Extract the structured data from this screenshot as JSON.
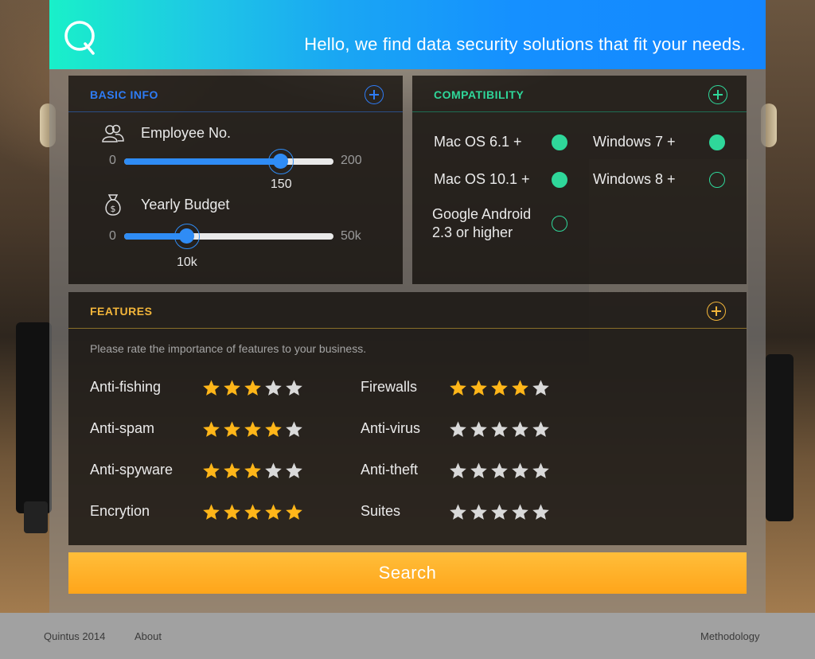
{
  "header": {
    "tagline": "Hello, we find data security solutions that fit your needs."
  },
  "basic_info": {
    "title": "BASIC INFO",
    "employees": {
      "label": "Employee No.",
      "min": "0",
      "max": "200",
      "value": "150",
      "fraction": 0.75
    },
    "budget": {
      "label": "Yearly Budget",
      "min": "0",
      "max": "50k",
      "value": "10k",
      "fraction": 0.3
    }
  },
  "compatibility": {
    "title": "COMPATIBILITY",
    "options": [
      {
        "label": "Mac OS 6.1 +",
        "checked": true
      },
      {
        "label": "Windows 7 +",
        "checked": true
      },
      {
        "label": "Mac OS 10.1 +",
        "checked": true
      },
      {
        "label": "Windows 8 +",
        "checked": false
      },
      {
        "label": "Google Android\n2.3 or higher",
        "checked": false
      }
    ]
  },
  "features": {
    "title": "FEATURES",
    "hint": "Please rate the importance of features to your business.",
    "items": [
      {
        "label": "Anti-fishing",
        "rating": 3
      },
      {
        "label": "Firewalls",
        "rating": 4
      },
      {
        "label": "Anti-spam",
        "rating": 4
      },
      {
        "label": "Anti-virus",
        "rating": 0
      },
      {
        "label": "Anti-spyware",
        "rating": 3
      },
      {
        "label": "Anti-theft",
        "rating": 0
      },
      {
        "label": "Encrytion",
        "rating": 5
      },
      {
        "label": "Suites",
        "rating": 0
      }
    ]
  },
  "search": {
    "label": "Search"
  },
  "footer": {
    "brand": "Quintus 2014",
    "about": "About",
    "methodology": "Methodology"
  },
  "colors": {
    "blue": "#2e7cf6",
    "green": "#2fd79a",
    "gold": "#f2b53a",
    "star_on": "#ffb619",
    "star_off": "#d9d9d9"
  }
}
